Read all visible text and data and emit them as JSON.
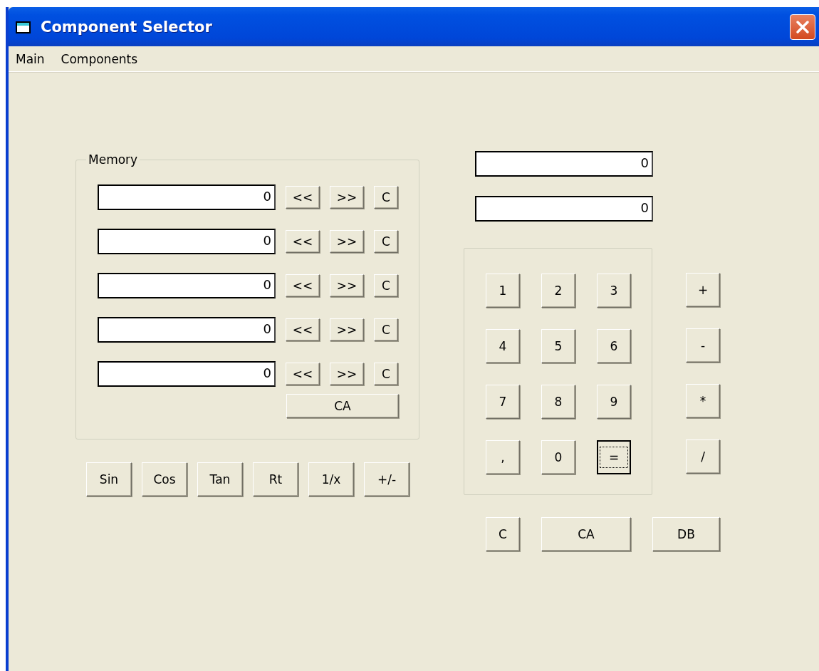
{
  "window": {
    "title": "Component Selector"
  },
  "menu": [
    "Main",
    "Components"
  ],
  "memory": {
    "label": "Memory",
    "rows": [
      {
        "value": "0",
        "buttons": [
          "<<",
          ">>",
          "C"
        ]
      },
      {
        "value": "0",
        "buttons": [
          "<<",
          ">>",
          "C"
        ]
      },
      {
        "value": "0",
        "buttons": [
          "<<",
          ">>",
          "C"
        ]
      },
      {
        "value": "0",
        "buttons": [
          "<<",
          ">>",
          "C"
        ]
      },
      {
        "value": "0",
        "buttons": [
          "<<",
          ">>",
          "C"
        ]
      }
    ],
    "clear_all": "CA"
  },
  "functions": [
    "Sin",
    "Cos",
    "Tan",
    "Rt",
    "1/x",
    "+/-"
  ],
  "displays": [
    "0",
    "0"
  ],
  "keypad": [
    {
      "label": "1",
      "focused": false
    },
    {
      "label": "2",
      "focused": false
    },
    {
      "label": "3",
      "focused": false
    },
    {
      "label": "4",
      "focused": false
    },
    {
      "label": "5",
      "focused": false
    },
    {
      "label": "6",
      "focused": false
    },
    {
      "label": "7",
      "focused": false
    },
    {
      "label": "8",
      "focused": false
    },
    {
      "label": "9",
      "focused": false
    },
    {
      "label": ",",
      "focused": false
    },
    {
      "label": "0",
      "focused": false
    },
    {
      "label": "=",
      "focused": true
    }
  ],
  "operators": [
    "+",
    "-",
    "*",
    "/"
  ],
  "bottom_buttons": [
    "C",
    "CA",
    "DB"
  ]
}
